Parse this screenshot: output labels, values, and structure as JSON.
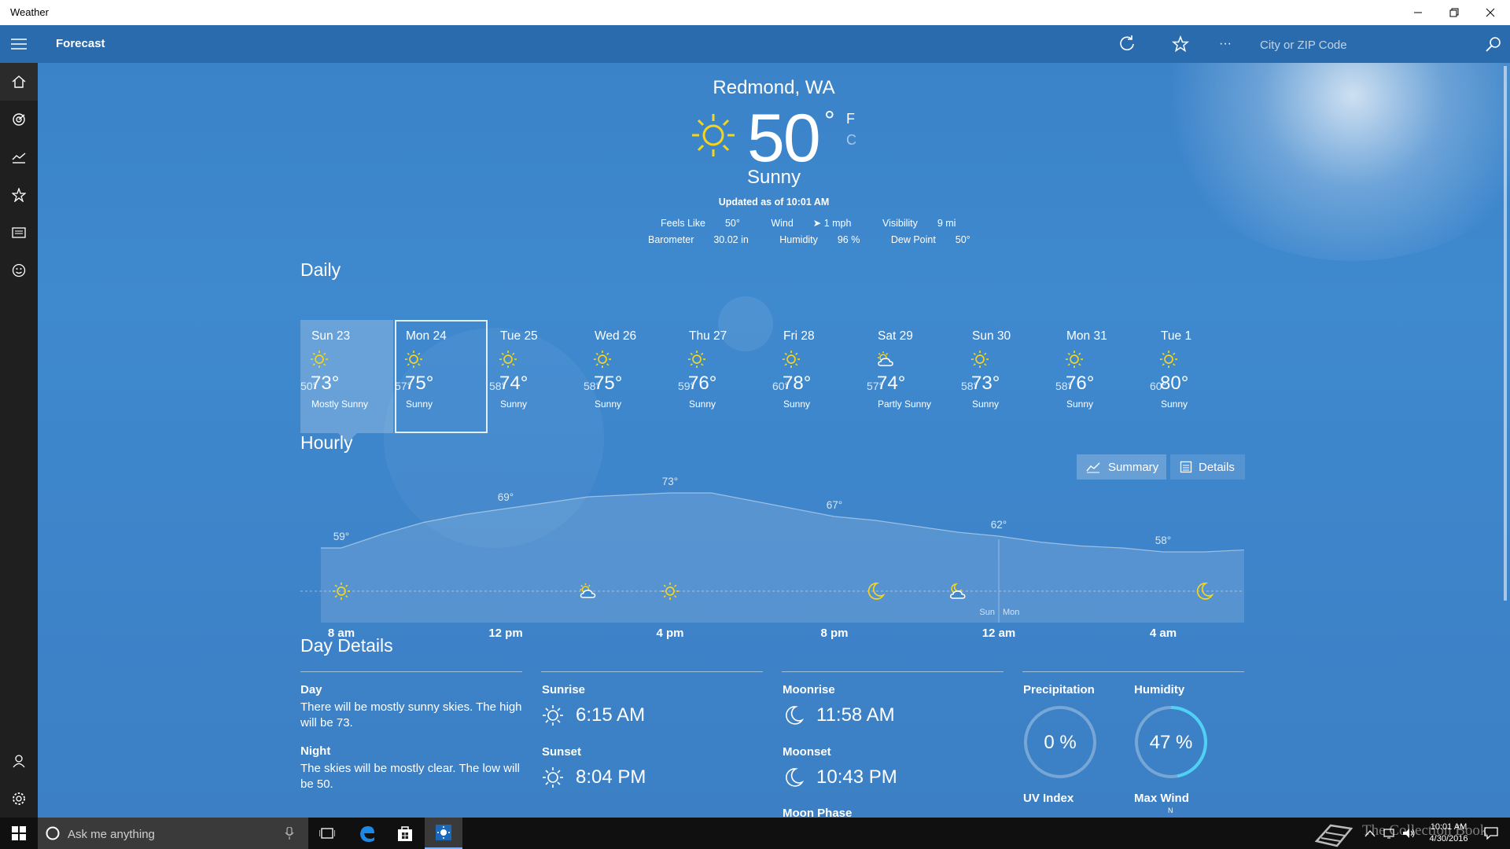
{
  "window": {
    "title": "Weather",
    "controls": {
      "minimize": "minimize-icon",
      "restore": "restore-icon",
      "close": "close-icon"
    }
  },
  "appbar": {
    "title": "Forecast",
    "search_placeholder": "City or ZIP Code",
    "more_label": "···"
  },
  "sidebar": {
    "items": [
      {
        "icon": "menu-icon"
      },
      {
        "icon": "home-icon"
      },
      {
        "icon": "radar-icon"
      },
      {
        "icon": "chart-icon"
      },
      {
        "icon": "favorites-icon"
      },
      {
        "icon": "news-icon"
      },
      {
        "icon": "smiley-icon"
      },
      {
        "icon": "account-icon"
      },
      {
        "icon": "settings-icon"
      }
    ]
  },
  "current": {
    "location": "Redmond, WA",
    "temp": "50",
    "degree": "°",
    "unit_f": "F",
    "unit_c": "C",
    "condition": "Sunny",
    "updated": "Updated as of 10:01 AM",
    "stats_row1": [
      {
        "label": "Feels Like",
        "value": "50°"
      },
      {
        "label": "Wind",
        "value": "➤ 1 mph"
      },
      {
        "label": "Visibility",
        "value": "9 mi"
      }
    ],
    "stats_row2": [
      {
        "label": "Barometer",
        "value": "30.02 in"
      },
      {
        "label": "Humidity",
        "value": "96 %"
      },
      {
        "label": "Dew Point",
        "value": "50°"
      }
    ]
  },
  "daily": {
    "heading": "Daily",
    "days": [
      {
        "name": "Sun 23",
        "hi": "73°",
        "lo": "50°",
        "cond": "Mostly Sunny",
        "icon": "sun-icon"
      },
      {
        "name": "Mon 24",
        "hi": "75°",
        "lo": "57°",
        "cond": "Sunny",
        "icon": "sun-icon"
      },
      {
        "name": "Tue 25",
        "hi": "74°",
        "lo": "58°",
        "cond": "Sunny",
        "icon": "sun-icon"
      },
      {
        "name": "Wed 26",
        "hi": "75°",
        "lo": "58°",
        "cond": "Sunny",
        "icon": "sun-icon"
      },
      {
        "name": "Thu 27",
        "hi": "76°",
        "lo": "59°",
        "cond": "Sunny",
        "icon": "sun-icon"
      },
      {
        "name": "Fri 28",
        "hi": "78°",
        "lo": "60°",
        "cond": "Sunny",
        "icon": "sun-icon"
      },
      {
        "name": "Sat 29",
        "hi": "74°",
        "lo": "57°",
        "cond": "Partly Sunny",
        "icon": "partly-sunny-icon"
      },
      {
        "name": "Sun 30",
        "hi": "73°",
        "lo": "58°",
        "cond": "Sunny",
        "icon": "sun-icon"
      },
      {
        "name": "Mon 31",
        "hi": "76°",
        "lo": "58°",
        "cond": "Sunny",
        "icon": "sun-icon"
      },
      {
        "name": "Tue 1",
        "hi": "80°",
        "lo": "60°",
        "cond": "Sunny",
        "icon": "sun-icon"
      }
    ]
  },
  "hourly": {
    "heading": "Hourly",
    "summary_label": "Summary",
    "details_label": "Details",
    "labels": [
      {
        "text": "59°",
        "hour": 0
      },
      {
        "text": "69°",
        "hour": 4
      },
      {
        "text": "73°",
        "hour": 8
      },
      {
        "text": "67°",
        "hour": 12
      },
      {
        "text": "62°",
        "hour": 16
      },
      {
        "text": "58°",
        "hour": 20
      }
    ],
    "icons": [
      {
        "hour": 0,
        "icon": "sun-icon"
      },
      {
        "hour": 6,
        "icon": "partly-sunny-icon"
      },
      {
        "hour": 8,
        "icon": "sun-icon"
      },
      {
        "hour": 13,
        "icon": "moon-icon"
      },
      {
        "hour": 15,
        "icon": "partly-cloudy-night-icon"
      },
      {
        "hour": 21,
        "icon": "moon-icon"
      }
    ],
    "time_labels": [
      {
        "text": "8 am",
        "hour": 0
      },
      {
        "text": "12 pm",
        "hour": 4
      },
      {
        "text": "4 pm",
        "hour": 8
      },
      {
        "text": "8 pm",
        "hour": 12
      },
      {
        "text": "12 am",
        "hour": 16
      },
      {
        "text": "4 am",
        "hour": 20
      }
    ],
    "day_divider": {
      "hour": 16,
      "before": "Sun",
      "after": "Mon"
    }
  },
  "chart_data": {
    "type": "area",
    "title": "Hourly",
    "x": [
      -0.5,
      0,
      1,
      2,
      3,
      4,
      5,
      6,
      7,
      8,
      9,
      10,
      11,
      12,
      13,
      14,
      15,
      16,
      17,
      18,
      19,
      20,
      21,
      22,
      23,
      23.5
    ],
    "y": [
      59,
      59,
      62.5,
      65.5,
      67.5,
      69,
      70.5,
      72,
      72.5,
      73,
      73,
      71,
      69,
      67,
      66,
      64.5,
      63,
      62,
      60.5,
      59.5,
      59,
      58,
      58,
      58.5,
      59,
      59
    ],
    "ylim": [
      40,
      80
    ],
    "xlabel": "",
    "ylabel": ""
  },
  "details": {
    "heading": "Day Details",
    "day_label": "Day",
    "day_text": "There will be mostly sunny skies. The high will be 73.",
    "night_label": "Night",
    "night_text": "The skies will be mostly clear. The low will be 50.",
    "sunrise_label": "Sunrise",
    "sunrise": "6:15 AM",
    "sunset_label": "Sunset",
    "sunset": "8:04 PM",
    "moonrise_label": "Moonrise",
    "moonrise": "11:58 AM",
    "moonset_label": "Moonset",
    "moonset": "10:43 PM",
    "moonphase_label": "Moon Phase",
    "precip_label": "Precipitation",
    "precip": "0 %",
    "precip_value": 0,
    "humidity_label": "Humidity",
    "humidity": "47 %",
    "humidity_value": 0.47,
    "uv_label": "UV Index",
    "maxwind_label": "Max Wind",
    "compass_n": "N"
  },
  "taskbar": {
    "search_placeholder": "Ask me anything",
    "time": "10:01 AM",
    "date": "4/30/2016"
  },
  "watermark": "The Collection Book",
  "colors": {
    "accent": "#2a6bad",
    "sun": "#f5d41c",
    "ring": "#4fd0f5"
  }
}
